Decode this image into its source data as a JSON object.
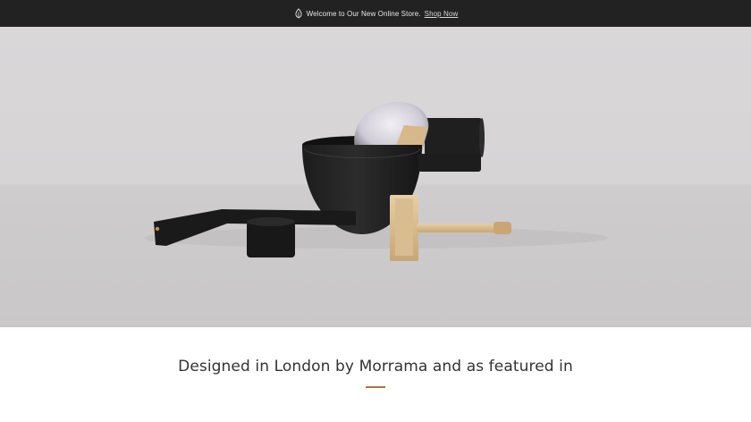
{
  "announcement": {
    "text": "Welcome to Our New Online Store.",
    "link_label": "Shop Now",
    "icon": "leaf-icon"
  },
  "hero": {
    "image": "shaving-set-product-photo"
  },
  "featured": {
    "heading": "Designed in London by Morrama and as featured in",
    "accent_color": "#a2783e"
  }
}
